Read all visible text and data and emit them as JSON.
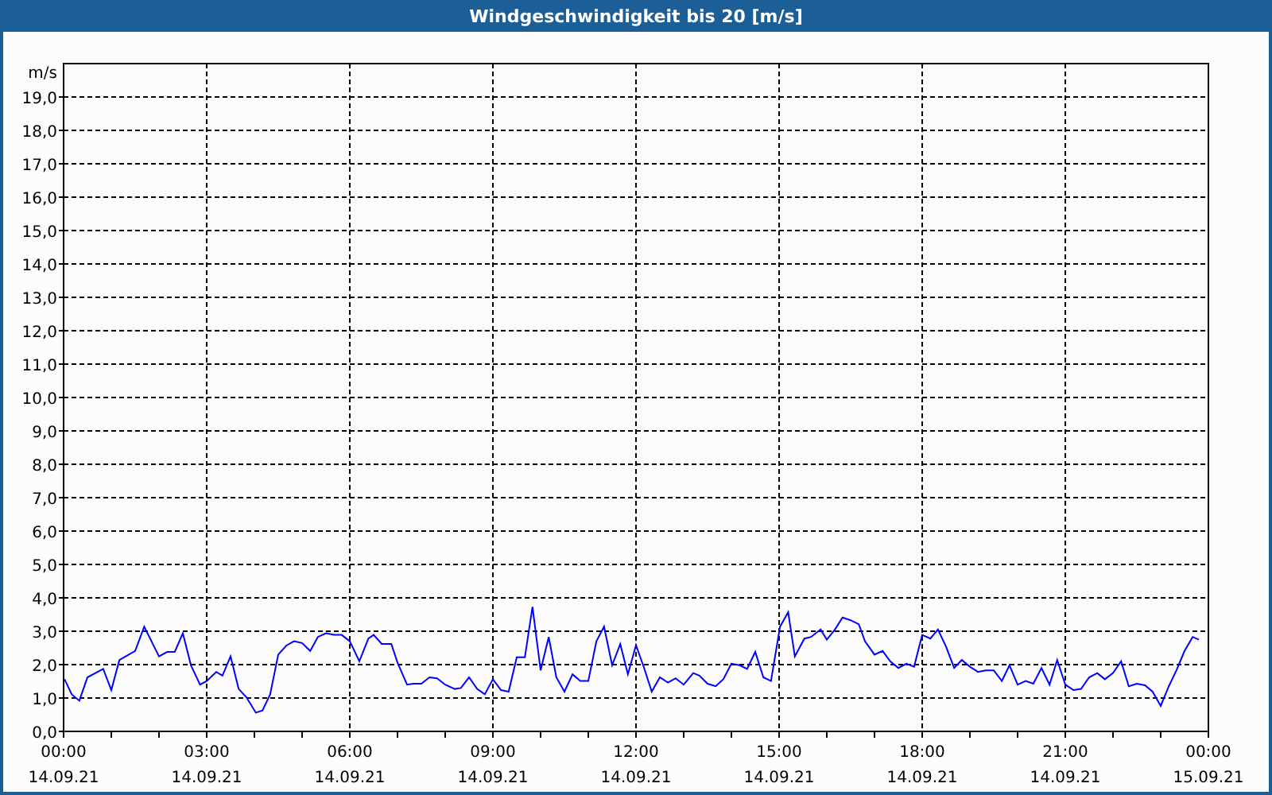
{
  "window": {
    "title": "Windgeschwindigkeit bis 20 [m/s]"
  },
  "chart": {
    "date_labels": [
      "14.09.21",
      "14.09.21",
      "14.09.21",
      "14.09.21",
      "14.09.21",
      "14.09.21",
      "14.09.21",
      "14.09.21",
      "15.09.21"
    ],
    "chart_data": {
      "type": "line",
      "grid": true,
      "ylabel": "m/s",
      "xlim": [
        0,
        24
      ],
      "ylim": [
        0,
        20
      ],
      "xticks": [
        {
          "value": 0,
          "label": "00:00"
        },
        {
          "value": 3,
          "label": "03:00"
        },
        {
          "value": 6,
          "label": "06:00"
        },
        {
          "value": 9,
          "label": "09:00"
        },
        {
          "value": 12,
          "label": "12:00"
        },
        {
          "value": 15,
          "label": "15:00"
        },
        {
          "value": 18,
          "label": "18:00"
        },
        {
          "value": 21,
          "label": "21:00"
        },
        {
          "value": 24,
          "label": "00:00"
        }
      ],
      "yticks": [
        {
          "value": 0,
          "label": "0,0"
        },
        {
          "value": 1,
          "label": "1,0"
        },
        {
          "value": 2,
          "label": "2,0"
        },
        {
          "value": 3,
          "label": "3,0"
        },
        {
          "value": 4,
          "label": "4,0"
        },
        {
          "value": 5,
          "label": "5,0"
        },
        {
          "value": 6,
          "label": "6,0"
        },
        {
          "value": 7,
          "label": "7,0"
        },
        {
          "value": 8,
          "label": "8,0"
        },
        {
          "value": 9,
          "label": "9,0"
        },
        {
          "value": 10,
          "label": "10,0"
        },
        {
          "value": 11,
          "label": "11,0"
        },
        {
          "value": 12,
          "label": "12,0"
        },
        {
          "value": 13,
          "label": "13,0"
        },
        {
          "value": 14,
          "label": "14,0"
        },
        {
          "value": 15,
          "label": "15,0"
        },
        {
          "value": 16,
          "label": "16,0"
        },
        {
          "value": 17,
          "label": "17,0"
        },
        {
          "value": 18,
          "label": "18,0"
        },
        {
          "value": 19,
          "label": "19,0"
        }
      ],
      "x": [
        0.02,
        0.17,
        0.33,
        0.5,
        0.83,
        1.0,
        1.17,
        1.5,
        1.69,
        2.0,
        2.17,
        2.33,
        2.5,
        2.67,
        2.86,
        3.0,
        3.2,
        3.33,
        3.5,
        3.67,
        3.83,
        4.03,
        4.17,
        4.33,
        4.5,
        4.67,
        4.83,
        5.0,
        5.17,
        5.33,
        5.5,
        5.67,
        5.83,
        6.0,
        6.2,
        6.39,
        6.5,
        6.67,
        6.87,
        7.0,
        7.2,
        7.33,
        7.5,
        7.67,
        7.83,
        8.0,
        8.2,
        8.33,
        8.5,
        8.67,
        8.83,
        9.0,
        9.17,
        9.33,
        9.5,
        9.67,
        9.83,
        10.0,
        10.17,
        10.33,
        10.5,
        10.67,
        10.83,
        11.0,
        11.17,
        11.33,
        11.5,
        11.67,
        11.83,
        12.0,
        12.17,
        12.33,
        12.5,
        12.67,
        12.83,
        13.0,
        13.2,
        13.33,
        13.5,
        13.67,
        13.83,
        14.0,
        14.17,
        14.33,
        14.5,
        14.67,
        14.83,
        15.02,
        15.19,
        15.33,
        15.53,
        15.67,
        15.87,
        16.0,
        16.17,
        16.33,
        16.5,
        16.67,
        16.8,
        17.0,
        17.17,
        17.33,
        17.5,
        17.67,
        17.83,
        18.0,
        18.17,
        18.33,
        18.5,
        18.67,
        18.83,
        19.0,
        19.17,
        19.33,
        19.5,
        19.67,
        19.83,
        20.0,
        20.17,
        20.33,
        20.5,
        20.67,
        20.83,
        21.0,
        21.17,
        21.33,
        21.5,
        21.67,
        21.83,
        22.0,
        22.17,
        22.33,
        22.5,
        22.67,
        22.83,
        23.0,
        23.17,
        23.33,
        23.5,
        23.67,
        23.8
      ],
      "series": [
        {
          "color": "#0000ff",
          "values": [
            1.56,
            1.11,
            0.92,
            1.62,
            1.87,
            1.24,
            2.14,
            2.41,
            3.14,
            2.25,
            2.38,
            2.38,
            2.94,
            1.98,
            1.4,
            1.51,
            1.78,
            1.67,
            2.25,
            1.27,
            1.03,
            0.56,
            0.63,
            1.11,
            2.3,
            2.57,
            2.7,
            2.65,
            2.41,
            2.83,
            2.94,
            2.89,
            2.89,
            2.7,
            2.1,
            2.78,
            2.89,
            2.62,
            2.62,
            2.06,
            1.4,
            1.43,
            1.43,
            1.62,
            1.59,
            1.4,
            1.27,
            1.3,
            1.62,
            1.27,
            1.11,
            1.56,
            1.24,
            1.19,
            2.22,
            2.22,
            3.73,
            1.83,
            2.83,
            1.62,
            1.19,
            1.71,
            1.51,
            1.51,
            2.7,
            3.14,
            1.98,
            2.62,
            1.71,
            2.58,
            1.9,
            1.19,
            1.62,
            1.46,
            1.59,
            1.4,
            1.75,
            1.67,
            1.43,
            1.35,
            1.56,
            2.03,
            1.98,
            1.87,
            2.38,
            1.62,
            1.51,
            3.14,
            3.57,
            2.25,
            2.78,
            2.83,
            3.05,
            2.75,
            3.05,
            3.41,
            3.33,
            3.21,
            2.7,
            2.3,
            2.41,
            2.1,
            1.9,
            2.03,
            1.94,
            2.89,
            2.78,
            3.05,
            2.54,
            1.9,
            2.14,
            1.94,
            1.78,
            1.83,
            1.83,
            1.51,
            1.98,
            1.4,
            1.51,
            1.43,
            1.9,
            1.4,
            2.14,
            1.4,
            1.24,
            1.27,
            1.62,
            1.75,
            1.56,
            1.75,
            2.1,
            1.35,
            1.43,
            1.38,
            1.19,
            0.76,
            1.35,
            1.83,
            2.41,
            2.83,
            2.75
          ]
        }
      ]
    }
  }
}
